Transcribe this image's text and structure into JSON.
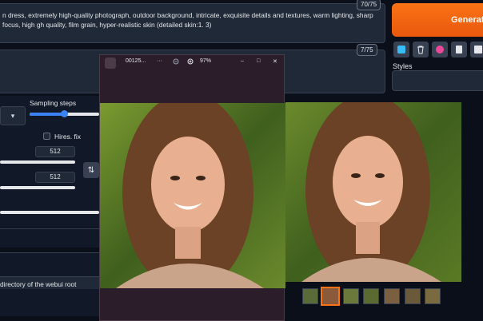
{
  "prompt": {
    "positive_text": "n dress, extremely high-quality photograph, outdoor background, intricate, exquisite details and textures, warm lighting, sharp focus, high gh quality, film grain, hyper-realistic skin (detailed skin:1. 3)",
    "positive_count": "70/75",
    "negative_count": "7/75"
  },
  "actions": {
    "generate_label": "Generate",
    "styles_label": "Styles"
  },
  "settings": {
    "sampling_steps_label": "Sampling steps",
    "sampler_chevron": "▾",
    "hires_fix_label": "Hires. fix",
    "width_value": "512",
    "height_value": "512",
    "swap_icon": "⇅",
    "directory_text": "directory of the webui root"
  },
  "viewer": {
    "filename": "00125...",
    "more_icon": "···",
    "zoom": "97%",
    "min_icon": "–",
    "max_icon": "□",
    "close_icon": "✕"
  },
  "colors": {
    "accent": "#f97316",
    "slider": "#3b82f6",
    "background": "#0b0f19"
  }
}
